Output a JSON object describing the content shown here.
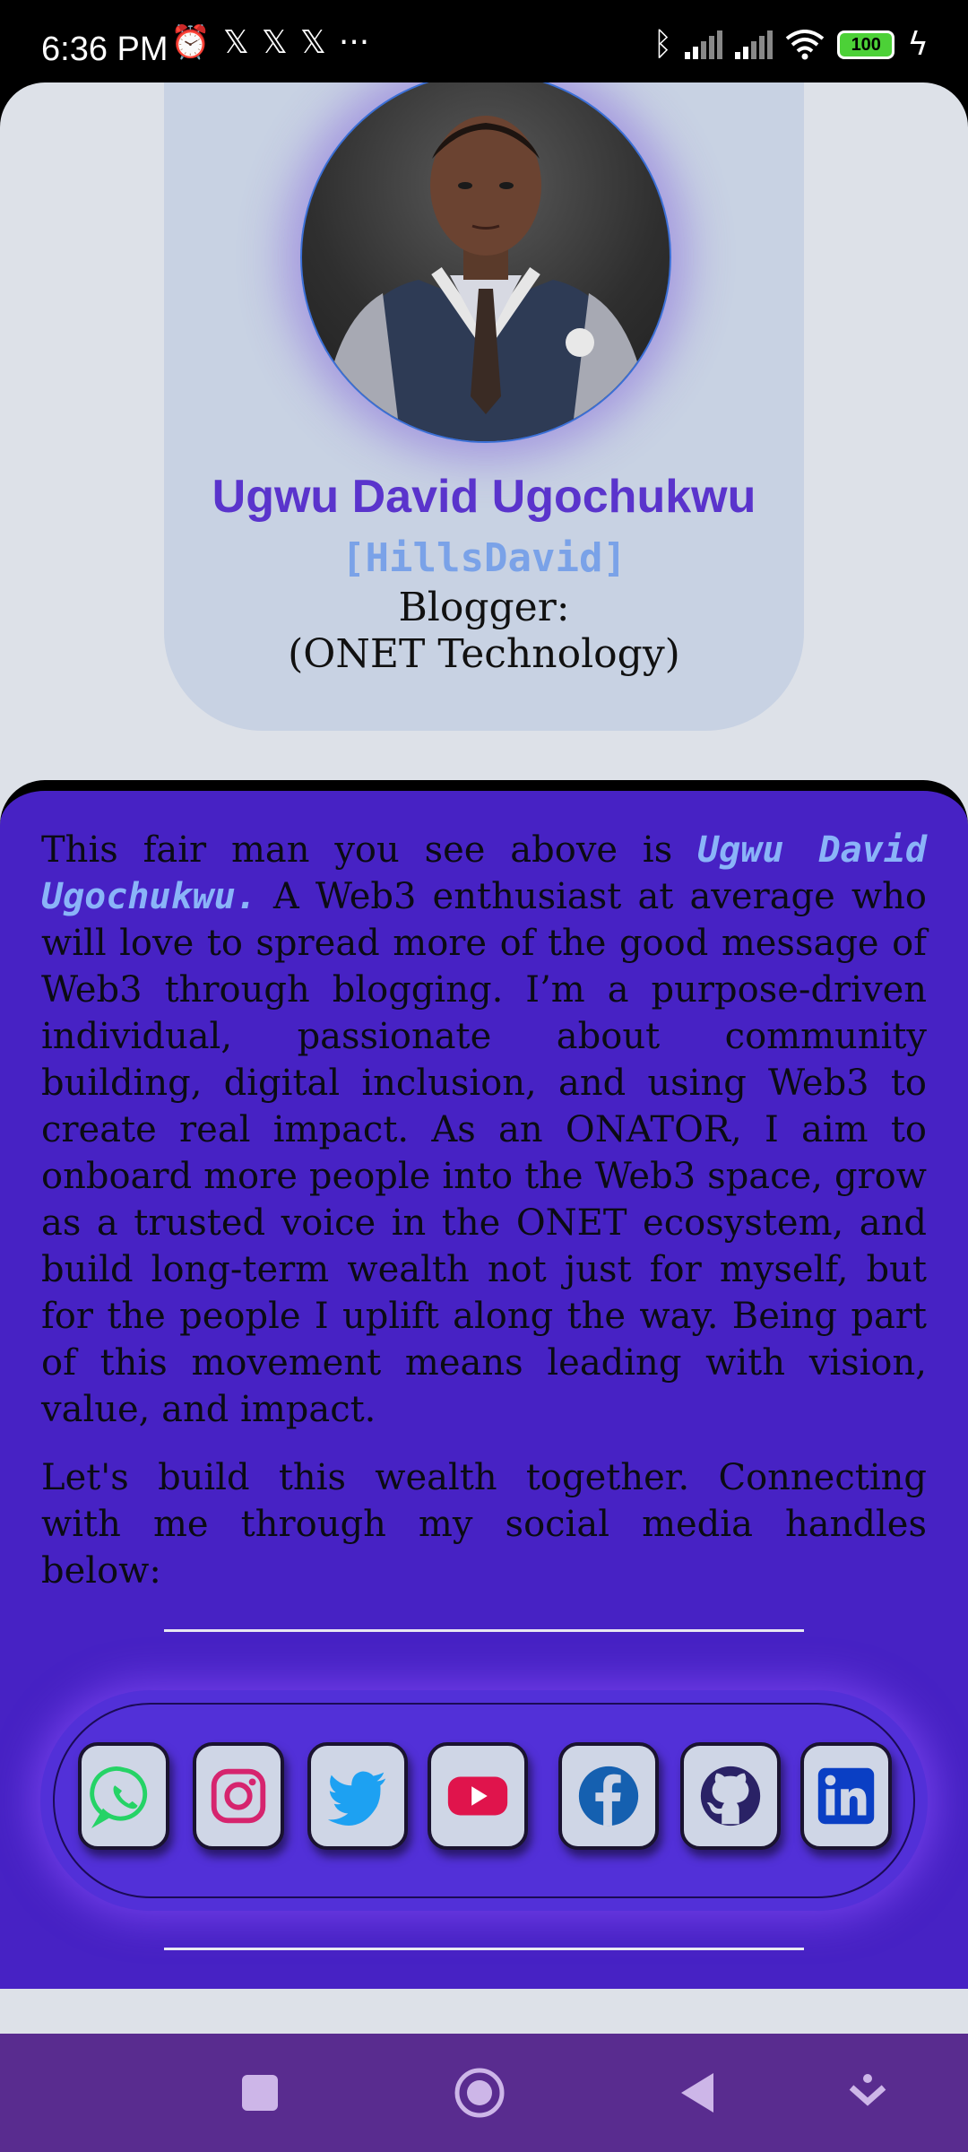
{
  "status_bar": {
    "time": "6:36 PM",
    "battery": "100",
    "left_icons": [
      "alarm-icon",
      "x-icon",
      "x-icon",
      "x-icon",
      "more-dots-icon"
    ],
    "right_icons": [
      "bluetooth-icon",
      "signal-icon",
      "signal-icon",
      "wifi-icon",
      "battery-icon",
      "charging-icon"
    ]
  },
  "profile": {
    "name": "Ugwu David Ugochukwu",
    "handle": "[HillsDavid]",
    "role_line1": "Blogger:",
    "role_line2": "(ONET Technology)"
  },
  "bio": {
    "intro": "This fair man you see above is",
    "name_highlight": "Ugwu David Ugochukwu.",
    "body": "A Web3 enthusiast at average who will love to spread more of the good message of Web3 through blogging. I’m a purpose-driven individual, passionate about community building, digital inclusion, and using Web3 to create real impact. As an ONATOR, I aim to onboard more people into the Web3 space, grow as a trusted voice in the ONET ecosystem, and build long-term wealth not just for myself, but for the people I uplift along the way. Being part of this movement means leading with vision, value, and impact.",
    "cta": "Let's build this wealth together. Connecting with me through my social media handles below:"
  },
  "social_links": [
    "whatsapp-icon",
    "instagram-icon",
    "twitter-icon",
    "youtube-icon",
    "facebook-icon",
    "github-icon",
    "linkedin-icon"
  ],
  "colors": {
    "accent": "#5a34cc",
    "handle": "#7aa2e8",
    "section_bg": "#4722c4",
    "card_bg": "#c8d2e3",
    "nav_bg": "#592c8f"
  },
  "nav_bar": [
    "recent-apps-icon",
    "home-icon",
    "back-icon",
    "hide-keyboard-icon"
  ]
}
